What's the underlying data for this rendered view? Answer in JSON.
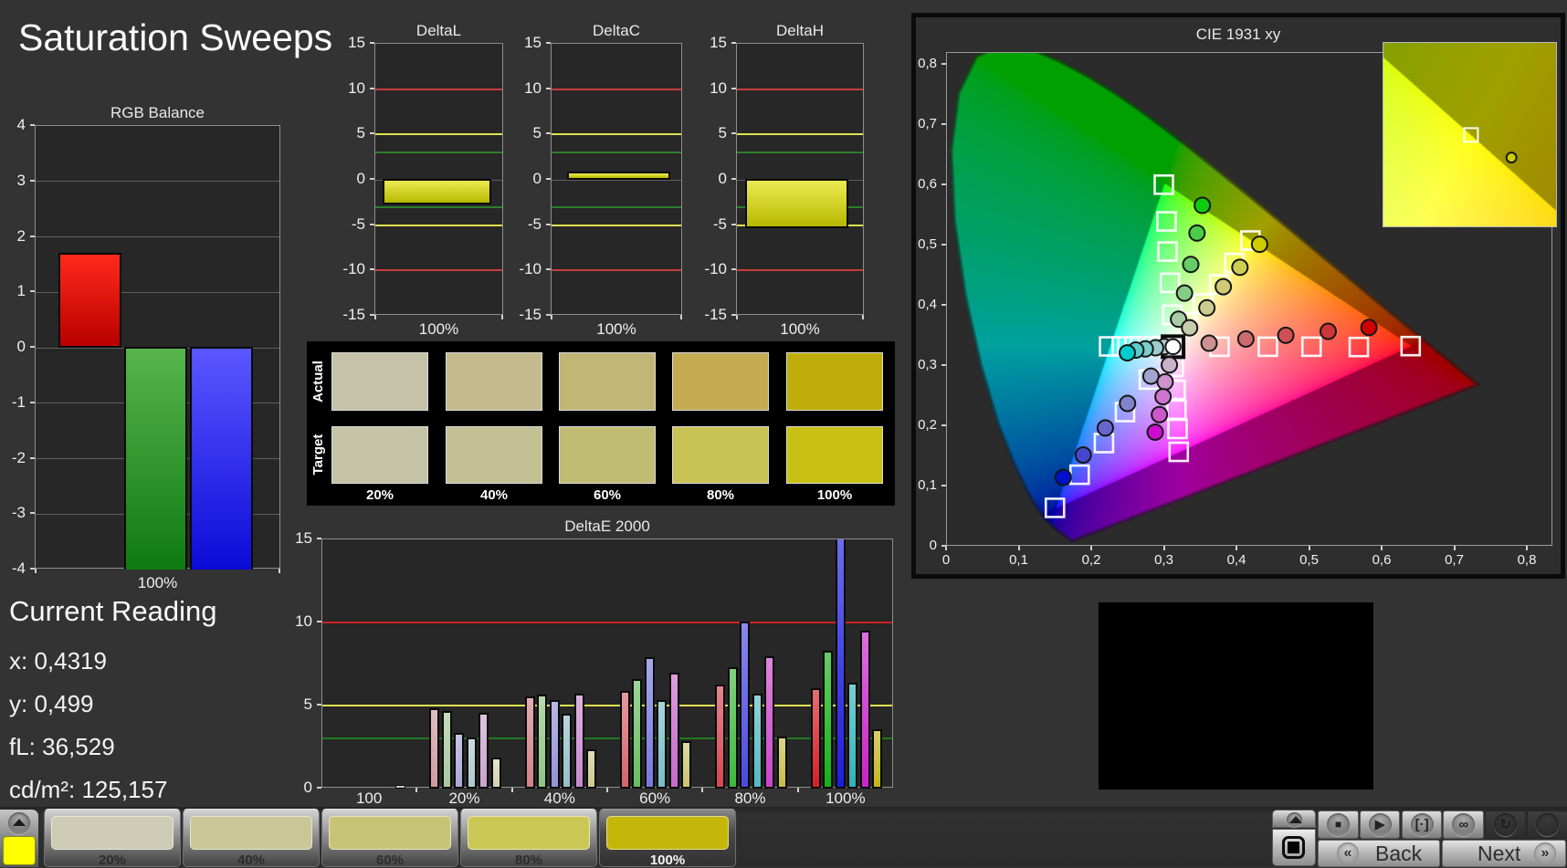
{
  "page": {
    "title": "Saturation Sweeps",
    "background": "#333333"
  },
  "current_reading": {
    "title": "Current Reading",
    "lines": [
      "x: 0,4319",
      "y: 0,499",
      "fL: 36,529",
      "cd/m²: 125,157"
    ]
  },
  "swatch_table": {
    "row_labels": [
      "Actual",
      "Target"
    ],
    "column_labels": [
      "20%",
      "40%",
      "60%",
      "80%",
      "100%"
    ],
    "actual_colors": [
      "#c6c2a7",
      "#c4ba8c",
      "#c2b677",
      "#c4ab52",
      "#bfae0a"
    ],
    "target_colors": [
      "#c5c3a6",
      "#c3c094",
      "#c1bc73",
      "#c9c254",
      "#c9c114"
    ]
  },
  "chart_data": [
    {
      "id": "rgb_balance",
      "type": "bar",
      "title": "RGB Balance",
      "categories": [
        "100%"
      ],
      "ylim": [
        -4,
        4
      ],
      "ytick_step": 1,
      "ytick_labels": [
        "4",
        "3",
        "2",
        "1",
        "0",
        "-1",
        "-2",
        "-3",
        "-4"
      ],
      "xtick_labels": [
        "100%"
      ],
      "series": [
        {
          "name": "Red",
          "value": 1.7,
          "clipped": false,
          "color_top": "#ff2a1a",
          "color_bottom": "#b80000"
        },
        {
          "name": "Green",
          "value": -4,
          "clipped": true,
          "color_top": "#57b44e",
          "color_bottom": "#0f7a12"
        },
        {
          "name": "Blue",
          "value": -4,
          "clipped": true,
          "color_top": "#5a57ff",
          "color_bottom": "#0b0bd8"
        }
      ]
    },
    {
      "id": "deltaL",
      "type": "bar",
      "title": "DeltaL",
      "categories": [
        "100%"
      ],
      "ylim": [
        -15,
        15
      ],
      "ytick_step": 5,
      "ytick_labels": [
        "15",
        "10",
        "5",
        "0",
        "-5",
        "-10",
        "-15"
      ],
      "xtick_labels": [
        "100%"
      ],
      "values": [
        -2.7
      ],
      "reflines": [
        {
          "v": 10,
          "color": "#c83c3c"
        },
        {
          "v": 5,
          "color": "#e0e052"
        },
        {
          "v": 3,
          "color": "#2b7e2b"
        },
        {
          "v": -3,
          "color": "#2b7e2b"
        },
        {
          "v": -5,
          "color": "#e0e052"
        },
        {
          "v": -10,
          "color": "#c83c3c"
        }
      ],
      "bar_color_top": "#ebeb52",
      "bar_color_bottom": "#b8b800"
    },
    {
      "id": "deltaC",
      "type": "bar",
      "title": "DeltaC",
      "categories": [
        "100%"
      ],
      "ylim": [
        -15,
        15
      ],
      "ytick_step": 5,
      "ytick_labels": [
        "15",
        "10",
        "5",
        "0",
        "-5",
        "-10",
        "-15"
      ],
      "xtick_labels": [
        "100%"
      ],
      "values": [
        0.8
      ],
      "reflines": [
        {
          "v": 10,
          "color": "#c83c3c"
        },
        {
          "v": 5,
          "color": "#e0e052"
        },
        {
          "v": 3,
          "color": "#2b7e2b"
        },
        {
          "v": -3,
          "color": "#2b7e2b"
        },
        {
          "v": -5,
          "color": "#e0e052"
        },
        {
          "v": -10,
          "color": "#c83c3c"
        }
      ],
      "bar_color_top": "#ebeb52",
      "bar_color_bottom": "#b8b800"
    },
    {
      "id": "deltaH",
      "type": "bar",
      "title": "DeltaH",
      "categories": [
        "100%"
      ],
      "ylim": [
        -15,
        15
      ],
      "ytick_step": 5,
      "ytick_labels": [
        "15",
        "10",
        "5",
        "0",
        "-5",
        "-10",
        "-15"
      ],
      "xtick_labels": [
        "100%"
      ],
      "values": [
        -5.3
      ],
      "reflines": [
        {
          "v": 10,
          "color": "#c83c3c"
        },
        {
          "v": 5,
          "color": "#e0e052"
        },
        {
          "v": 3,
          "color": "#2b7e2b"
        },
        {
          "v": -3,
          "color": "#2b7e2b"
        },
        {
          "v": -5,
          "color": "#e0e052"
        },
        {
          "v": -10,
          "color": "#c83c3c"
        }
      ],
      "bar_color_top": "#ebeb52",
      "bar_color_bottom": "#b8b800"
    },
    {
      "id": "deltaE2000",
      "type": "bar",
      "title": "DeltaE 2000",
      "ylim": [
        0,
        15
      ],
      "yticks": [
        0,
        5,
        10,
        15
      ],
      "ytick_labels": [
        "15",
        "10",
        "5",
        "0"
      ],
      "reflines": [
        {
          "v": 10,
          "color": "#cc2323"
        },
        {
          "v": 5,
          "color": "#e0e052"
        },
        {
          "v": 3,
          "color": "#1f7a1f"
        }
      ],
      "series_names": [
        "White",
        "Red",
        "Green",
        "Blue",
        "Cyan",
        "Magenta",
        "Yellow"
      ],
      "groups": [
        {
          "label": "100",
          "values": [
            0.15
          ],
          "colors": [
            "#bdbdbd"
          ]
        },
        {
          "label": "20%",
          "values": [
            4.8,
            4.6,
            3.3,
            3.0,
            4.5,
            1.8
          ],
          "colors": [
            "#cf9ba0",
            "#a9c89d",
            "#a8a8d8",
            "#afc8ce",
            "#c9a4ce",
            "#d6d2ae"
          ]
        },
        {
          "label": "40%",
          "values": [
            5.5,
            5.6,
            5.25,
            4.45,
            5.65,
            2.3
          ],
          "colors": [
            "#d28087",
            "#8ec383",
            "#9292da",
            "#94c0ca",
            "#c788ce",
            "#cfc990"
          ]
        },
        {
          "label": "60%",
          "values": [
            5.8,
            6.55,
            7.85,
            5.3,
            6.9,
            2.8
          ],
          "colors": [
            "#d4646c",
            "#68bd60",
            "#7877de",
            "#78bdc7",
            "#c768cc",
            "#ccc46b"
          ]
        },
        {
          "label": "80%",
          "values": [
            6.2,
            7.25,
            10.0,
            5.65,
            7.9,
            3.1
          ],
          "colors": [
            "#d4464f",
            "#3eb83d",
            "#4b48de",
            "#54b9c1",
            "#c945c9",
            "#c8bd46"
          ]
        },
        {
          "label": "100%",
          "values": [
            6.0,
            8.25,
            15.0,
            6.3,
            9.45,
            3.5
          ],
          "colors": [
            "#d32027",
            "#13b212",
            "#1d1dde",
            "#2db4b9",
            "#c922c9",
            "#c2b51e"
          ],
          "clipped": [
            false,
            false,
            true,
            false,
            false,
            false
          ]
        }
      ]
    },
    {
      "id": "cie1931",
      "type": "scatter",
      "title": "CIE 1931 xy",
      "xlim": [
        0,
        0.835
      ],
      "ylim": [
        0,
        0.8197
      ],
      "xticks": [
        "0",
        "0,1",
        "0,2",
        "0,3",
        "0,4",
        "0,5",
        "0,6",
        "0,7",
        "0,8"
      ],
      "yticks": [
        "0",
        "0,1",
        "0,2",
        "0,3",
        "0,4",
        "0,5",
        "0,6",
        "0,7",
        "0,8"
      ],
      "gamut_triangle": {
        "red": [
          0.64,
          0.33
        ],
        "green": [
          0.3,
          0.6
        ],
        "blue": [
          0.15,
          0.06
        ]
      },
      "white_point": {
        "x": 0.3127,
        "y": 0.329
      },
      "white_measured": {
        "x": 0.3127,
        "y": 0.329
      },
      "targets": {
        "red": [
          [
            0.3767,
            0.329
          ],
          [
            0.4433,
            0.329
          ],
          [
            0.5034,
            0.329
          ],
          [
            0.5686,
            0.3285
          ],
          [
            0.64,
            0.33
          ]
        ],
        "green": [
          [
            0.3117,
            0.382
          ],
          [
            0.3085,
            0.435
          ],
          [
            0.305,
            0.487
          ],
          [
            0.3038,
            0.537
          ],
          [
            0.3,
            0.598
          ]
        ],
        "blue": [
          [
            0.2794,
            0.2745
          ],
          [
            0.2465,
            0.2205
          ],
          [
            0.2175,
            0.169
          ],
          [
            0.184,
            0.1165
          ],
          [
            0.15,
            0.0615
          ]
        ],
        "cyan": [
          [
            0.2951,
            0.3295
          ],
          [
            0.2775,
            0.3295
          ],
          [
            0.2598,
            0.3295
          ],
          [
            0.2422,
            0.3295
          ],
          [
            0.2246,
            0.3295
          ]
        ],
        "magenta": [
          [
            0.3136,
            0.2955
          ],
          [
            0.3162,
            0.2575
          ],
          [
            0.3174,
            0.2245
          ],
          [
            0.3188,
            0.1925
          ],
          [
            0.3205,
            0.1545
          ]
        ],
        "yellow": [
          [
            0.3313,
            0.369
          ],
          [
            0.3536,
            0.4008
          ],
          [
            0.3765,
            0.4324
          ],
          [
            0.3971,
            0.468
          ],
          [
            0.4193,
            0.5053
          ]
        ]
      },
      "measured": {
        "red": [
          [
            0.3623,
            0.3348
          ],
          [
            0.413,
            0.3418
          ],
          [
            0.468,
            0.348
          ],
          [
            0.5264,
            0.3545
          ],
          [
            0.5826,
            0.3609
          ]
        ],
        "green": [
          [
            0.3203,
            0.3747
          ],
          [
            0.3285,
            0.4179
          ],
          [
            0.3371,
            0.4656
          ],
          [
            0.3457,
            0.5177
          ],
          [
            0.353,
            0.5636
          ]
        ],
        "blue": [
          [
            0.2823,
            0.2802
          ],
          [
            0.25,
            0.2348
          ],
          [
            0.2194,
            0.1941
          ],
          [
            0.189,
            0.1492
          ],
          [
            0.1614,
            0.1121
          ]
        ],
        "cyan": [
          [
            0.3005,
            0.3291
          ],
          [
            0.2886,
            0.3272
          ],
          [
            0.2745,
            0.3253
          ],
          [
            0.2615,
            0.3234
          ],
          [
            0.2497,
            0.3188
          ]
        ],
        "magenta": [
          [
            0.3076,
            0.2988
          ],
          [
            0.3018,
            0.2706
          ],
          [
            0.2989,
            0.2461
          ],
          [
            0.2939,
            0.2163
          ],
          [
            0.2881,
            0.1872
          ]
        ],
        "yellow": [
          [
            0.3355,
            0.3604
          ],
          [
            0.3593,
            0.3935
          ],
          [
            0.3819,
            0.4286
          ],
          [
            0.4048,
            0.4608
          ],
          [
            0.4319,
            0.499
          ]
        ]
      },
      "inset": {
        "x_range": [
          0.392,
          0.4458
        ],
        "y_range": [
          0.4798,
          0.531
        ],
        "target": [
          0.4193,
          0.5053
        ],
        "measured": [
          0.4319,
          0.499
        ]
      }
    }
  ],
  "bottom_panel": {
    "color": "#000000"
  },
  "toolbar": {
    "pattern_swatch_color": "#ffff00",
    "pattern_buttons": [
      {
        "label": "20%",
        "color": "#cdcbb4",
        "selected": false
      },
      {
        "label": "40%",
        "color": "#cac698",
        "selected": false
      },
      {
        "label": "60%",
        "color": "#c8c477",
        "selected": false
      },
      {
        "label": "80%",
        "color": "#cbc754",
        "selected": false
      },
      {
        "label": "100%",
        "color": "#c4b70a",
        "selected": true
      }
    ],
    "media_buttons": [
      {
        "icon": "stop",
        "disabled": false
      },
      {
        "icon": "play",
        "disabled": false
      },
      {
        "icon": "bracket-dot",
        "disabled": false
      },
      {
        "icon": "infinity",
        "disabled": false
      },
      {
        "icon": "refresh",
        "disabled": true
      },
      {
        "icon": "blank",
        "disabled": true
      }
    ],
    "nav": {
      "back_label": "Back",
      "next_label": "Next"
    }
  }
}
